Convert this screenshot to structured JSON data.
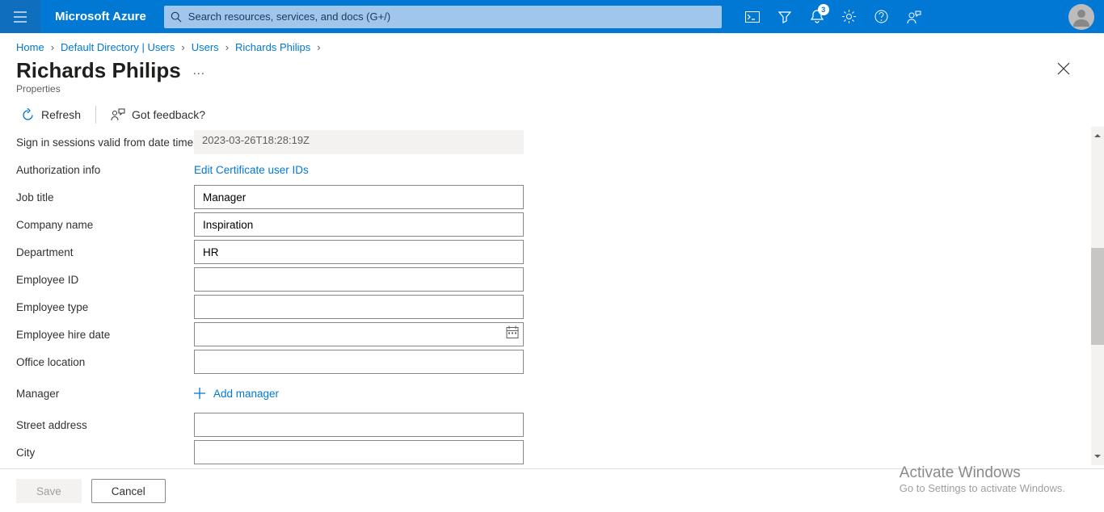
{
  "header": {
    "brand": "Microsoft Azure",
    "search_placeholder": "Search resources, services, and docs (G+/)",
    "notification_count": "3"
  },
  "breadcrumbs": {
    "items": [
      "Home",
      "Default Directory | Users",
      "Users",
      "Richards Philips"
    ]
  },
  "title": {
    "name": "Richards Philips",
    "subtitle": "Properties"
  },
  "toolbar": {
    "refresh": "Refresh",
    "feedback": "Got feedback?"
  },
  "form": {
    "signin_sessions_label": "Sign in sessions valid from date time",
    "signin_sessions_value": "2023-03-26T18:28:19Z",
    "authorization_label": "Authorization info",
    "authorization_link": "Edit Certificate user IDs",
    "job_title_label": "Job title",
    "job_title_value": "Manager",
    "company_label": "Company name",
    "company_value": "Inspiration",
    "department_label": "Department",
    "department_value": "HR",
    "employee_id_label": "Employee ID",
    "employee_id_value": "",
    "employee_type_label": "Employee type",
    "employee_type_value": "",
    "hire_date_label": "Employee hire date",
    "hire_date_value": "",
    "office_label": "Office location",
    "office_value": "",
    "manager_label": "Manager",
    "manager_add": "Add manager",
    "street_label": "Street address",
    "street_value": "",
    "city_label": "City",
    "city_value": ""
  },
  "footer": {
    "save": "Save",
    "cancel": "Cancel"
  },
  "watermark": {
    "title": "Activate Windows",
    "sub": "Go to Settings to activate Windows."
  }
}
